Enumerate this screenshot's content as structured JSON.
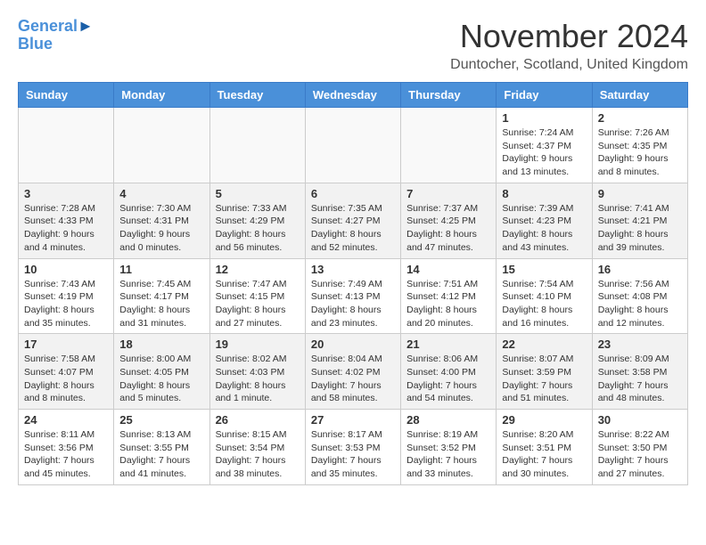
{
  "header": {
    "logo_line1": "General",
    "logo_line2": "Blue",
    "month": "November 2024",
    "location": "Duntocher, Scotland, United Kingdom"
  },
  "weekdays": [
    "Sunday",
    "Monday",
    "Tuesday",
    "Wednesday",
    "Thursday",
    "Friday",
    "Saturday"
  ],
  "weeks": [
    [
      {
        "day": "",
        "info": ""
      },
      {
        "day": "",
        "info": ""
      },
      {
        "day": "",
        "info": ""
      },
      {
        "day": "",
        "info": ""
      },
      {
        "day": "",
        "info": ""
      },
      {
        "day": "1",
        "info": "Sunrise: 7:24 AM\nSunset: 4:37 PM\nDaylight: 9 hours and 13 minutes."
      },
      {
        "day": "2",
        "info": "Sunrise: 7:26 AM\nSunset: 4:35 PM\nDaylight: 9 hours and 8 minutes."
      }
    ],
    [
      {
        "day": "3",
        "info": "Sunrise: 7:28 AM\nSunset: 4:33 PM\nDaylight: 9 hours and 4 minutes."
      },
      {
        "day": "4",
        "info": "Sunrise: 7:30 AM\nSunset: 4:31 PM\nDaylight: 9 hours and 0 minutes."
      },
      {
        "day": "5",
        "info": "Sunrise: 7:33 AM\nSunset: 4:29 PM\nDaylight: 8 hours and 56 minutes."
      },
      {
        "day": "6",
        "info": "Sunrise: 7:35 AM\nSunset: 4:27 PM\nDaylight: 8 hours and 52 minutes."
      },
      {
        "day": "7",
        "info": "Sunrise: 7:37 AM\nSunset: 4:25 PM\nDaylight: 8 hours and 47 minutes."
      },
      {
        "day": "8",
        "info": "Sunrise: 7:39 AM\nSunset: 4:23 PM\nDaylight: 8 hours and 43 minutes."
      },
      {
        "day": "9",
        "info": "Sunrise: 7:41 AM\nSunset: 4:21 PM\nDaylight: 8 hours and 39 minutes."
      }
    ],
    [
      {
        "day": "10",
        "info": "Sunrise: 7:43 AM\nSunset: 4:19 PM\nDaylight: 8 hours and 35 minutes."
      },
      {
        "day": "11",
        "info": "Sunrise: 7:45 AM\nSunset: 4:17 PM\nDaylight: 8 hours and 31 minutes."
      },
      {
        "day": "12",
        "info": "Sunrise: 7:47 AM\nSunset: 4:15 PM\nDaylight: 8 hours and 27 minutes."
      },
      {
        "day": "13",
        "info": "Sunrise: 7:49 AM\nSunset: 4:13 PM\nDaylight: 8 hours and 23 minutes."
      },
      {
        "day": "14",
        "info": "Sunrise: 7:51 AM\nSunset: 4:12 PM\nDaylight: 8 hours and 20 minutes."
      },
      {
        "day": "15",
        "info": "Sunrise: 7:54 AM\nSunset: 4:10 PM\nDaylight: 8 hours and 16 minutes."
      },
      {
        "day": "16",
        "info": "Sunrise: 7:56 AM\nSunset: 4:08 PM\nDaylight: 8 hours and 12 minutes."
      }
    ],
    [
      {
        "day": "17",
        "info": "Sunrise: 7:58 AM\nSunset: 4:07 PM\nDaylight: 8 hours and 8 minutes."
      },
      {
        "day": "18",
        "info": "Sunrise: 8:00 AM\nSunset: 4:05 PM\nDaylight: 8 hours and 5 minutes."
      },
      {
        "day": "19",
        "info": "Sunrise: 8:02 AM\nSunset: 4:03 PM\nDaylight: 8 hours and 1 minute."
      },
      {
        "day": "20",
        "info": "Sunrise: 8:04 AM\nSunset: 4:02 PM\nDaylight: 7 hours and 58 minutes."
      },
      {
        "day": "21",
        "info": "Sunrise: 8:06 AM\nSunset: 4:00 PM\nDaylight: 7 hours and 54 minutes."
      },
      {
        "day": "22",
        "info": "Sunrise: 8:07 AM\nSunset: 3:59 PM\nDaylight: 7 hours and 51 minutes."
      },
      {
        "day": "23",
        "info": "Sunrise: 8:09 AM\nSunset: 3:58 PM\nDaylight: 7 hours and 48 minutes."
      }
    ],
    [
      {
        "day": "24",
        "info": "Sunrise: 8:11 AM\nSunset: 3:56 PM\nDaylight: 7 hours and 45 minutes."
      },
      {
        "day": "25",
        "info": "Sunrise: 8:13 AM\nSunset: 3:55 PM\nDaylight: 7 hours and 41 minutes."
      },
      {
        "day": "26",
        "info": "Sunrise: 8:15 AM\nSunset: 3:54 PM\nDaylight: 7 hours and 38 minutes."
      },
      {
        "day": "27",
        "info": "Sunrise: 8:17 AM\nSunset: 3:53 PM\nDaylight: 7 hours and 35 minutes."
      },
      {
        "day": "28",
        "info": "Sunrise: 8:19 AM\nSunset: 3:52 PM\nDaylight: 7 hours and 33 minutes."
      },
      {
        "day": "29",
        "info": "Sunrise: 8:20 AM\nSunset: 3:51 PM\nDaylight: 7 hours and 30 minutes."
      },
      {
        "day": "30",
        "info": "Sunrise: 8:22 AM\nSunset: 3:50 PM\nDaylight: 7 hours and 27 minutes."
      }
    ]
  ]
}
